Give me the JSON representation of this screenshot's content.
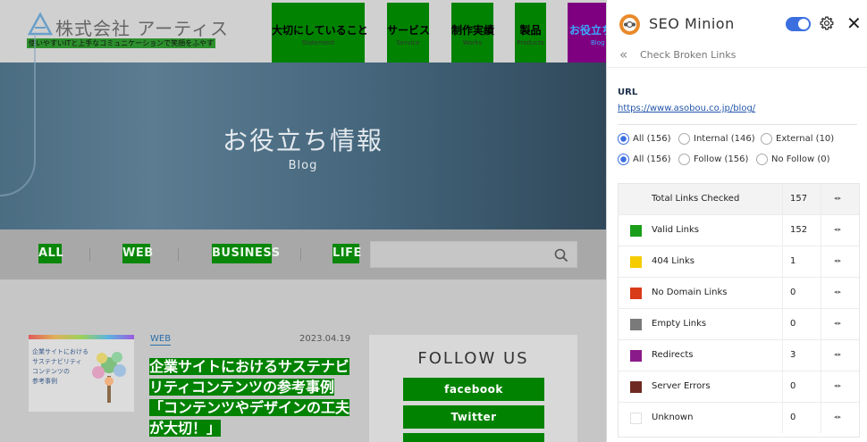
{
  "site": {
    "logo": {
      "name": "株式会社 アーティス",
      "tagline": "使いやすいITと上手なコミュニケーションで笑顔をふやす"
    },
    "nav": [
      {
        "jp": "大切にしていること",
        "en": "Statement"
      },
      {
        "jp": "サービス",
        "en": "Service"
      },
      {
        "jp": "制作実績",
        "en": "Works"
      },
      {
        "jp": "製品",
        "en": "Products"
      },
      {
        "jp": "お役立ち",
        "en": "Blog"
      }
    ],
    "hero": {
      "title": "お役立ち情報",
      "subtitle": "Blog"
    },
    "categories": [
      "ALL",
      "WEB",
      "BUSINESS",
      "LIFE"
    ],
    "search": {
      "placeholder": "",
      "icon": "search-icon"
    },
    "post": {
      "category": "WEB",
      "date": "2023.04.19",
      "title": "企業サイトにおけるサステナビリティコンテンツの参考事例「コンテンツやデザインの工夫が大切！」",
      "thumbnail_text": [
        "企業サイトにおける",
        "サステナビリティ",
        "コンテンツの",
        "参考事例"
      ]
    },
    "follow": {
      "title": "FOLLOW US",
      "buttons": [
        "facebook",
        "Twitter",
        ""
      ]
    }
  },
  "panel": {
    "title": "SEO Minion",
    "subtitle": "Check Broken Links",
    "url_label": "URL",
    "url": "https://www.asobou.co.jp/blog/",
    "filters_scope": [
      {
        "label": "All (156)",
        "selected": true
      },
      {
        "label": "Internal (146)",
        "selected": false
      },
      {
        "label": "External (10)",
        "selected": false
      }
    ],
    "filters_follow": [
      {
        "label": "All (156)",
        "selected": true
      },
      {
        "label": "Follow (156)",
        "selected": false
      },
      {
        "label": "No Follow (0)",
        "selected": false
      }
    ],
    "rows": [
      {
        "label": "Total Links Checked",
        "count": "157",
        "color": ""
      },
      {
        "label": "Valid Links",
        "count": "152",
        "color": "#1a9e1a"
      },
      {
        "label": "404 Links",
        "count": "1",
        "color": "#f5cc00"
      },
      {
        "label": "No Domain Links",
        "count": "0",
        "color": "#d93a1a"
      },
      {
        "label": "Empty Links",
        "count": "0",
        "color": "#7a7a7a"
      },
      {
        "label": "Redirects",
        "count": "3",
        "color": "#8a1a8a"
      },
      {
        "label": "Server Errors",
        "count": "0",
        "color": "#6e2a22"
      },
      {
        "label": "Unknown",
        "count": "0",
        "color": "#ffffff"
      }
    ],
    "arrows": "◂▸"
  }
}
